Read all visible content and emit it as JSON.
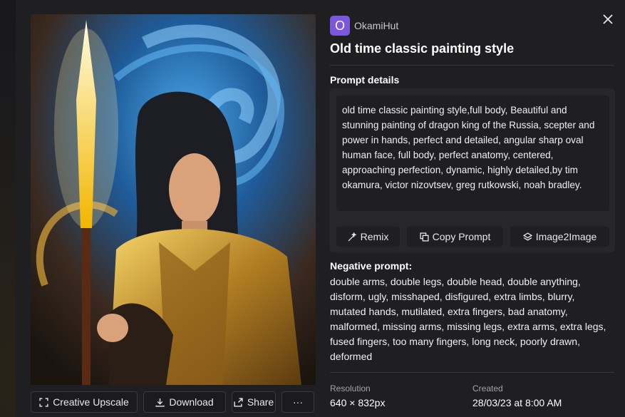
{
  "author": {
    "initial": "O",
    "name": "OkamiHut"
  },
  "title": "Old time classic painting style",
  "prompt_details_label": "Prompt details",
  "prompt": "old time classic painting style,full body, Beautiful and stunning painting of dragon king of the Russia, scepter and power in hands, perfect and detailed, angular sharp oval human face, full body, perfect anatomy, centered, approaching perfection, dynamic, highly detailed,by tim okamura, victor nizovtsev, greg rutkowski, noah bradley.",
  "prompt_actions": {
    "remix": "Remix",
    "copy": "Copy Prompt",
    "img2img": "Image2Image"
  },
  "negative_label": "Negative prompt:",
  "negative_prompt": "double arms, double legs, double head, double anything, disform, ugly, misshaped, disfigured, extra limbs, blurry, mutated hands, mutilated, extra fingers, bad anatomy, malformed, missing arms, missing legs, extra arms, extra legs, fused fingers, too many fingers, long neck, poorly drawn, deformed",
  "meta": {
    "resolution_label": "Resolution",
    "resolution": "640 × 832px",
    "created_label": "Created",
    "created": "28/03/23 at 8:00 AM"
  },
  "image_actions": {
    "upscale": "Creative Upscale",
    "download": "Download",
    "share": "Share",
    "more": "···"
  },
  "colors": {
    "avatar": "#7b57e0",
    "background": "#1f1f22",
    "card": "#27272b"
  }
}
